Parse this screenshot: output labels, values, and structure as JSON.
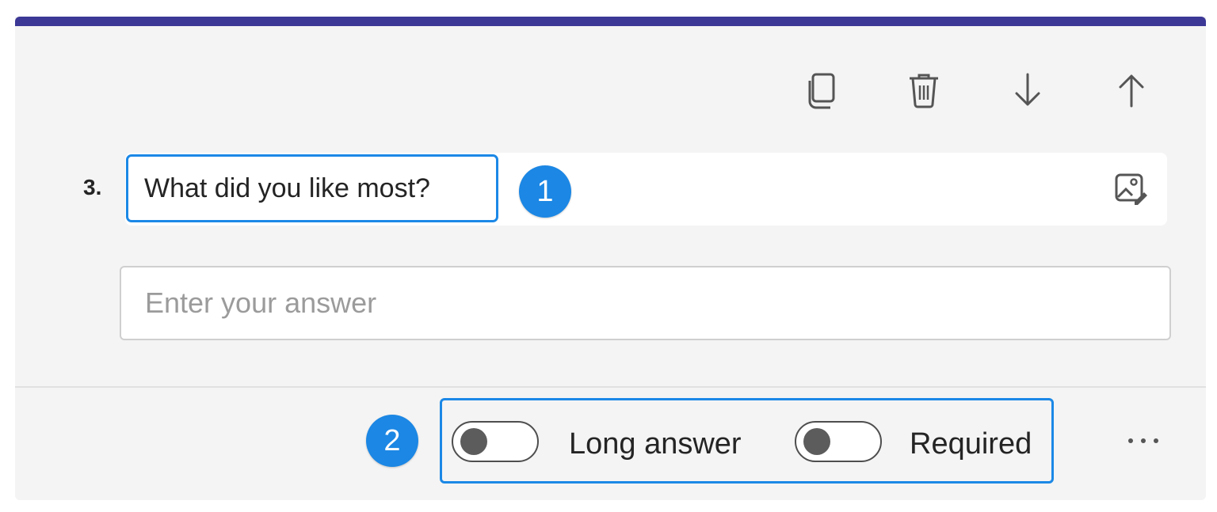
{
  "question": {
    "number": "3.",
    "title": "What did you like most?",
    "answer_placeholder": "Enter your answer"
  },
  "toolbar": {
    "icons": [
      "copy-icon",
      "delete-icon",
      "move-down-icon",
      "move-up-icon"
    ]
  },
  "callouts": {
    "badge_1": "1",
    "badge_2": "2"
  },
  "options": {
    "long_answer_label": "Long answer",
    "long_answer_on": false,
    "required_label": "Required",
    "required_on": false,
    "more_label": "..."
  },
  "colors": {
    "accent_bar": "#3b3896",
    "highlight": "#1b88e6",
    "badge": "#1c87e4"
  }
}
